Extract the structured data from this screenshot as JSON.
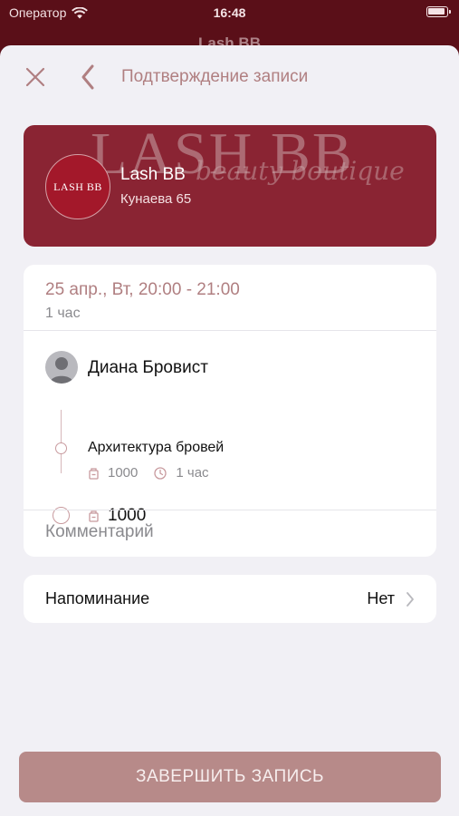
{
  "status_bar": {
    "carrier": "Оператор",
    "time": "16:48"
  },
  "background_app": {
    "title": "Lash BB"
  },
  "nav": {
    "title": "Подтверждение записи"
  },
  "salon": {
    "name": "Lash BB",
    "address": "Кунаева 65",
    "banner_text": "LASH BB",
    "banner_script": "beauty boutique",
    "logo_text": "LASH BB"
  },
  "appointment": {
    "datetime": "25 апр., Вт, 20:00 - 21:00",
    "duration": "1 час",
    "master_name": "Диана Бровист",
    "service": {
      "name": "Архитектура бровей",
      "price": "1000",
      "duration": "1 час"
    },
    "total": "1000"
  },
  "comment": {
    "placeholder": "Комментарий"
  },
  "reminder": {
    "label": "Напоминание",
    "value": "Нет"
  },
  "submit": {
    "label": "ЗАВЕРШИТЬ ЗАПИСЬ"
  },
  "colors": {
    "accent": "#b07f81",
    "brand": "#8a2433",
    "button": "#b78a89"
  }
}
